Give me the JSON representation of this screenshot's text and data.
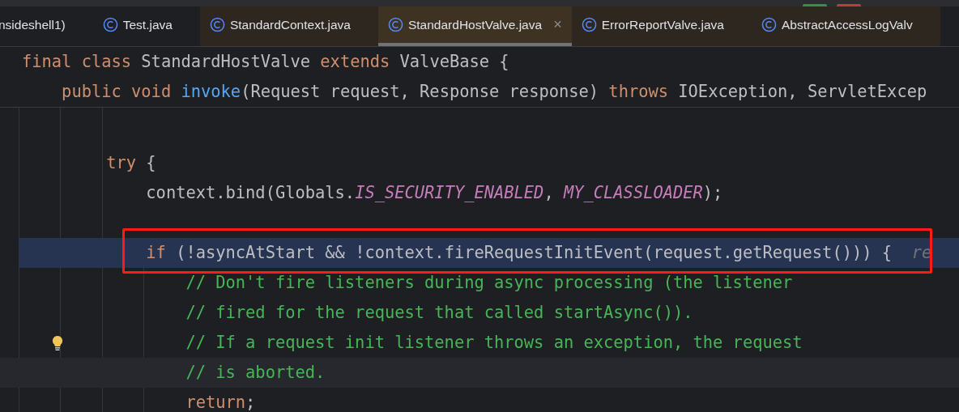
{
  "tabs": [
    {
      "label": "nsideshell1)",
      "selected": false,
      "tinted": false,
      "icon": false
    },
    {
      "label": "Test.java",
      "selected": false,
      "tinted": false,
      "icon": true
    },
    {
      "label": "StandardContext.java",
      "selected": false,
      "tinted": true,
      "icon": true
    },
    {
      "label": "StandardHostValve.java",
      "selected": true,
      "tinted": true,
      "icon": true,
      "close": "×"
    },
    {
      "label": "ErrorReportValve.java",
      "selected": false,
      "tinted": true,
      "icon": true
    },
    {
      "label": "AbstractAccessLogValv",
      "selected": false,
      "tinted": true,
      "icon": true
    }
  ],
  "sticky_lines": [
    {
      "tokens": [
        {
          "text": "final",
          "kind": "keyword"
        },
        {
          "text": " class",
          "kind": "keyword"
        },
        {
          "text": " StandardHostValve",
          "kind": "plain"
        },
        {
          "text": " extends",
          "kind": "keyword"
        },
        {
          "text": " ValveBase {",
          "kind": "plain"
        }
      ]
    },
    {
      "tokens": [
        {
          "text": "    public",
          "kind": "keyword"
        },
        {
          "text": " void",
          "kind": "keyword"
        },
        {
          "text": " invoke",
          "kind": "method"
        },
        {
          "text": "(Request request, Response response)",
          "kind": "plain"
        },
        {
          "text": " throws",
          "kind": "keyword"
        },
        {
          "text": " IOException, ServletExcep",
          "kind": "plain"
        }
      ]
    }
  ],
  "code_lines": [
    {
      "kind": "blank",
      "highlighted": false,
      "current": false
    },
    {
      "kind": "blank",
      "highlighted": false,
      "current": false
    },
    {
      "kind": "code",
      "highlighted": false,
      "current": false,
      "tokens": [
        {
          "text": "        try",
          "kind": "keyword"
        },
        {
          "text": " {",
          "kind": "plain"
        }
      ]
    },
    {
      "kind": "code",
      "highlighted": false,
      "current": false,
      "tokens": [
        {
          "text": "            context.bind(Globals.",
          "kind": "plain"
        },
        {
          "text": "IS_SECURITY_ENABLED",
          "kind": "constant"
        },
        {
          "text": ", ",
          "kind": "plain"
        },
        {
          "text": "MY_CLASSLOADER",
          "kind": "constant"
        },
        {
          "text": ");",
          "kind": "plain"
        }
      ]
    },
    {
      "kind": "blank",
      "highlighted": false,
      "current": false
    },
    {
      "kind": "code",
      "highlighted": true,
      "current": false,
      "boxed": true,
      "tokens": [
        {
          "text": "            if",
          "kind": "keyword"
        },
        {
          "text": " (!asyncAtStart && !context.fireRequestInitEvent(request.getRequest())) {",
          "kind": "plain"
        },
        {
          "text": "  re",
          "kind": "hint"
        }
      ]
    },
    {
      "kind": "code",
      "highlighted": false,
      "current": false,
      "tokens": [
        {
          "text": "                // Don't fire listeners during async processing (the listener",
          "kind": "comment"
        }
      ]
    },
    {
      "kind": "code",
      "highlighted": false,
      "current": false,
      "tokens": [
        {
          "text": "                // fired for the request that called startAsync()).",
          "kind": "comment"
        }
      ]
    },
    {
      "kind": "code",
      "highlighted": false,
      "current": false,
      "bulb": true,
      "tokens": [
        {
          "text": "                // If a request init listener throws an exception, the request",
          "kind": "comment"
        }
      ]
    },
    {
      "kind": "code",
      "highlighted": false,
      "current": true,
      "tokens": [
        {
          "text": "                // is aborted.",
          "kind": "comment"
        }
      ]
    },
    {
      "kind": "code",
      "highlighted": false,
      "current": false,
      "tokens": [
        {
          "text": "                return",
          "kind": "keyword"
        },
        {
          "text": ";",
          "kind": "plain"
        }
      ]
    }
  ]
}
